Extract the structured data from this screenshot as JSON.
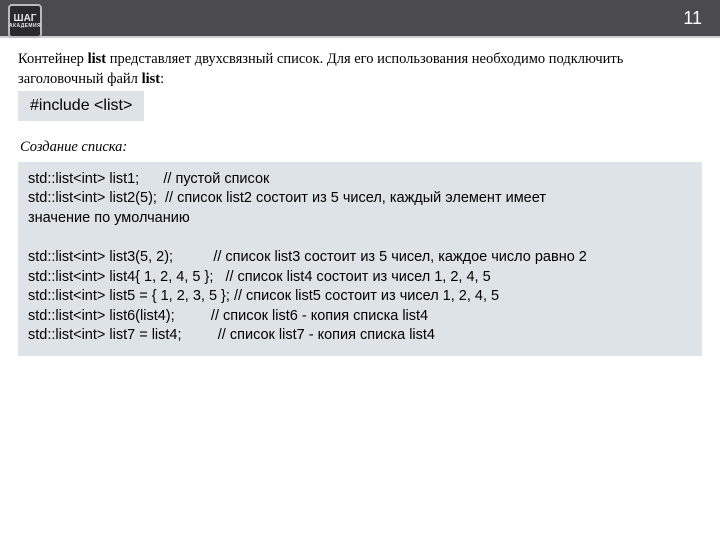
{
  "header": {
    "page_number": "11",
    "logo_text": "ШАГ",
    "logo_sub": "АКАДЕМИЯ"
  },
  "intro": {
    "pre": "Контейнер ",
    "kw1": "list",
    "mid": " представляет двухсвязный список. Для его использования необходимо подключить заголовочный файл ",
    "kw2": "list",
    "post": ":",
    "include_code": "#include <list>"
  },
  "subhead": "Создание списка:",
  "code_lines": [
    "std::list<int> list1;      // пустой список",
    "std::list<int> list2(5);  // список list2 состоит из 5 чисел, каждый элемент имеет",
    "значение по умолчанию",
    "",
    "std::list<int> list3(5, 2);          // список list3 состоит из 5 чисел, каждое число равно 2",
    "std::list<int> list4{ 1, 2, 4, 5 };   // список list4 состоит из чисел 1, 2, 4, 5",
    "std::list<int> list5 = { 1, 2, 3, 5 }; // список list5 состоит из чисел 1, 2, 4, 5",
    "std::list<int> list6(list4);         // список list6 - копия списка list4",
    "std::list<int> list7 = list4;         // список list7 - копия списка list4"
  ]
}
